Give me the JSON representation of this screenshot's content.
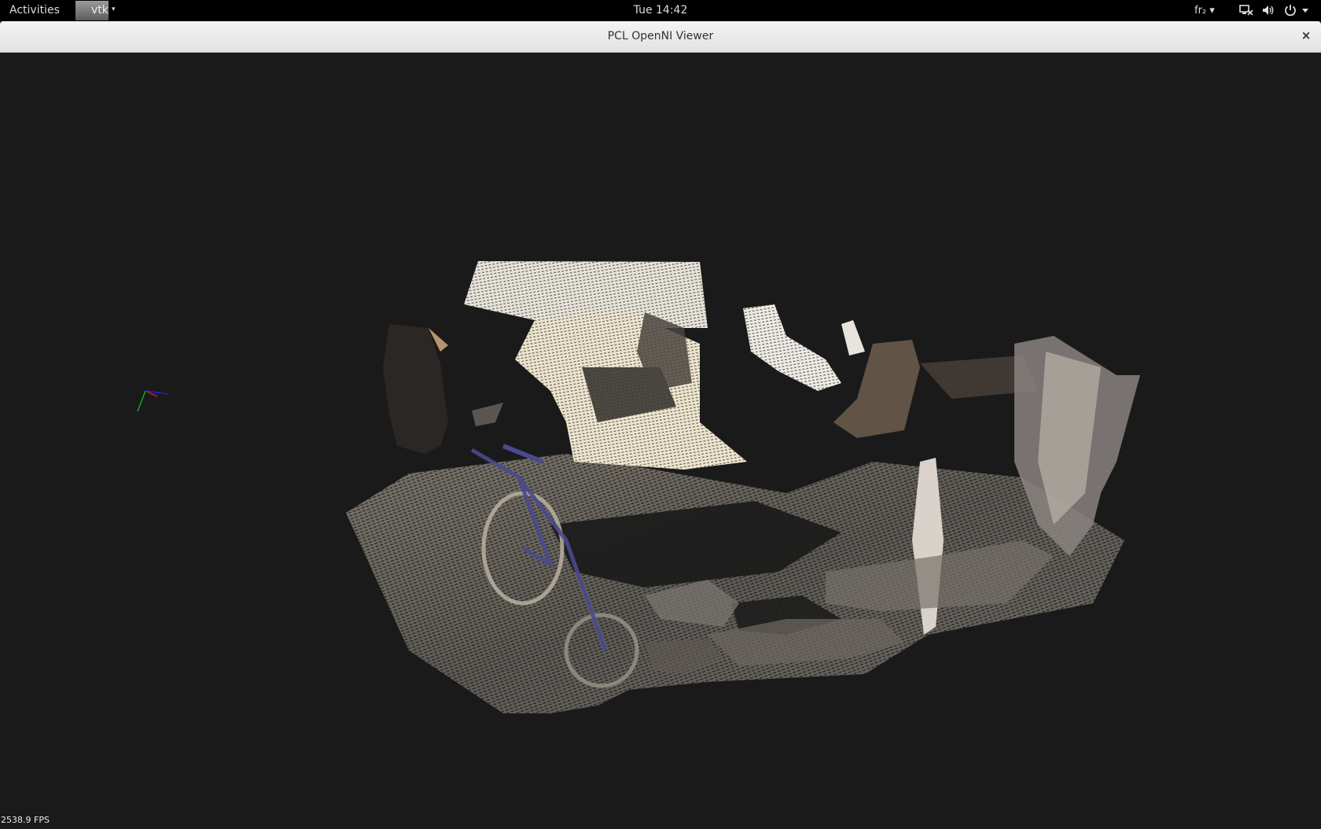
{
  "topbar": {
    "activities_label": "Activities",
    "app_name": "vtk",
    "app_arrow": "▾",
    "clock": "Tue 14:42",
    "keyboard_layout": "fr₂ ▾",
    "tray_icons": [
      "network-disconnected-icon",
      "volume-icon",
      "power-icon",
      "chevron-down-icon"
    ]
  },
  "window": {
    "title": "PCL OpenNI Viewer",
    "close_label": "×"
  },
  "viewer": {
    "background": "#1a1a1a",
    "fps_text": "2538.9 FPS",
    "axis_colors": {
      "x": "#ff2020",
      "y": "#20c020",
      "z": "#2020ff"
    }
  }
}
